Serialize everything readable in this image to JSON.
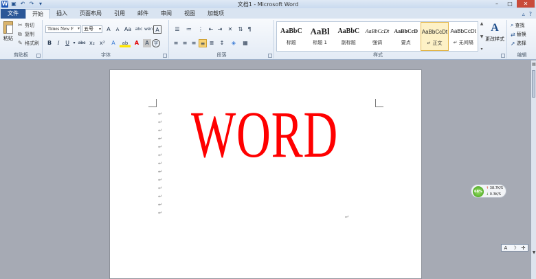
{
  "app": {
    "title": "文档1 - Microsoft Word",
    "qat": [
      "word-logo",
      "save-icon",
      "undo-icon",
      "redo-icon",
      "customize-icon"
    ],
    "window_controls": [
      "minimize-icon",
      "maximize-icon",
      "close-icon"
    ]
  },
  "tabs": {
    "file": "文件",
    "items": [
      "开始",
      "插入",
      "页面布局",
      "引用",
      "邮件",
      "审阅",
      "视图",
      "加载项"
    ],
    "active": "开始"
  },
  "ribbon": {
    "clipboard": {
      "label": "剪贴板",
      "paste": "粘贴",
      "cut": "剪切",
      "copy": "复制",
      "format_painter": "格式刷"
    },
    "font": {
      "label": "字体",
      "font_name": "Times New F",
      "font_size": "五号",
      "grow": "A",
      "shrink": "A",
      "case": "Aa",
      "clear": "abc",
      "pinyin": "wén",
      "border": "A",
      "bold": "B",
      "italic": "I",
      "underline": "U",
      "strike": "abc",
      "subscript": "x₂",
      "superscript": "x²",
      "effects": "A",
      "highlight": "ab",
      "font_color": "A",
      "shading": "A",
      "enclose": "字"
    },
    "paragraph": {
      "label": "段落"
    },
    "styles": {
      "label": "样式",
      "items": [
        {
          "preview": "AaBbC",
          "name": "标题"
        },
        {
          "preview": "AaBl",
          "name": "标题 1"
        },
        {
          "preview": "AaBbC",
          "name": "副标题"
        },
        {
          "preview": "AaBbCcDt",
          "name": "强调"
        },
        {
          "preview": "AaBbCcD",
          "name": "要点"
        },
        {
          "preview": "AaBbCcDt",
          "name": "↵ 正文"
        },
        {
          "preview": "AaBbCcDt",
          "name": "↵ 无间隔"
        }
      ],
      "selected_index": 5,
      "change_styles": "更改样式"
    },
    "editing": {
      "label": "编辑",
      "find": "查找",
      "replace": "替换",
      "select": "选择"
    }
  },
  "document": {
    "big_text": "WORD",
    "big_text_color": "#ff0000",
    "paragraph_marks": [
      "↵",
      "↵",
      "↵",
      "↵",
      "↵",
      "↵",
      "↵",
      "↵",
      "↵",
      "↵",
      "↵",
      "↵",
      "↵"
    ],
    "end_mark": "↵"
  },
  "net_widget": {
    "percent": "68%",
    "upload": "38.7K/S",
    "download": "0.3K/S"
  },
  "ime_bar": [
    "A",
    "☽",
    "✢"
  ]
}
